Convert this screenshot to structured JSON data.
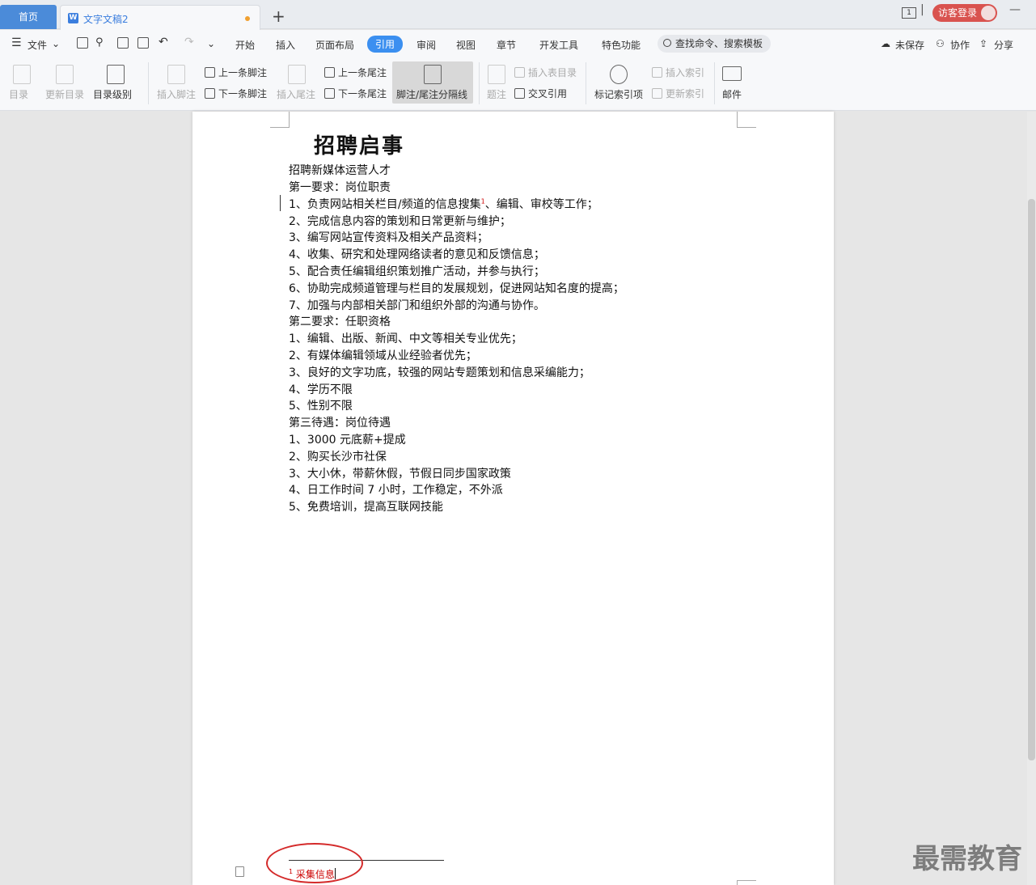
{
  "tabs": {
    "home": "首页",
    "doc_title": "文字文稿2"
  },
  "titlebar": {
    "page_indicator": "1",
    "login": "访客登录"
  },
  "menu": {
    "file": "文件",
    "items": [
      "开始",
      "插入",
      "页面布局",
      "引用",
      "审阅",
      "视图",
      "章节",
      "开发工具",
      "特色功能"
    ],
    "active": "引用",
    "search_placeholder": "查找命令、搜索模板",
    "unsaved": "未保存",
    "collab": "协作",
    "share": "分享"
  },
  "ribbon": {
    "toc": "目录",
    "update_toc": "更新目录",
    "toc_level": "目录级别",
    "insert_footnote": "插入脚注",
    "prev_footnote": "上一条脚注",
    "next_footnote": "下一条脚注",
    "insert_endnote": "插入尾注",
    "prev_endnote": "上一条尾注",
    "next_endnote": "下一条尾注",
    "fn_separator": "脚注/尾注分隔线",
    "caption": "题注",
    "insert_table_of_figures": "插入表目录",
    "cross_ref": "交叉引用",
    "mark_index": "标记索引项",
    "insert_index": "插入索引",
    "update_index": "更新索引",
    "mail": "邮件"
  },
  "document": {
    "title": "招聘启事",
    "lines": [
      "招聘新媒体运营人才",
      "第一要求：岗位职责",
      "1、负责网站相关栏目/频道的信息搜集",
      "2、完成信息内容的策划和日常更新与维护；",
      "3、编写网站宣传资料及相关产品资料；",
      "4、收集、研究和处理网络读者的意见和反馈信息；",
      "5、配合责任编辑组织策划推广活动，并参与执行；",
      "6、协助完成频道管理与栏目的发展规划，促进网站知名度的提高；",
      "7、加强与内部相关部门和组织外部的沟通与协作。",
      "第二要求：任职资格",
      "1、编辑、出版、新闻、中文等相关专业优先；",
      "2、有媒体编辑领域从业经验者优先；",
      "3、良好的文字功底，较强的网站专题策划和信息采编能力；",
      "4、学历不限",
      "5、性别不限",
      "第三待遇：岗位待遇",
      "1、3000 元底薪+提成",
      "2、购买长沙市社保",
      "3、大小休，带薪休假，节假日同步国家政策",
      "4、日工作时间 7 小时，工作稳定，不外派",
      "5、免费培训，提高互联网技能"
    ],
    "line1_after_ref": "、编辑、审校等工作；",
    "footnote_ref": "1",
    "footnote_text": "采集信息"
  },
  "watermark": "最需教育"
}
